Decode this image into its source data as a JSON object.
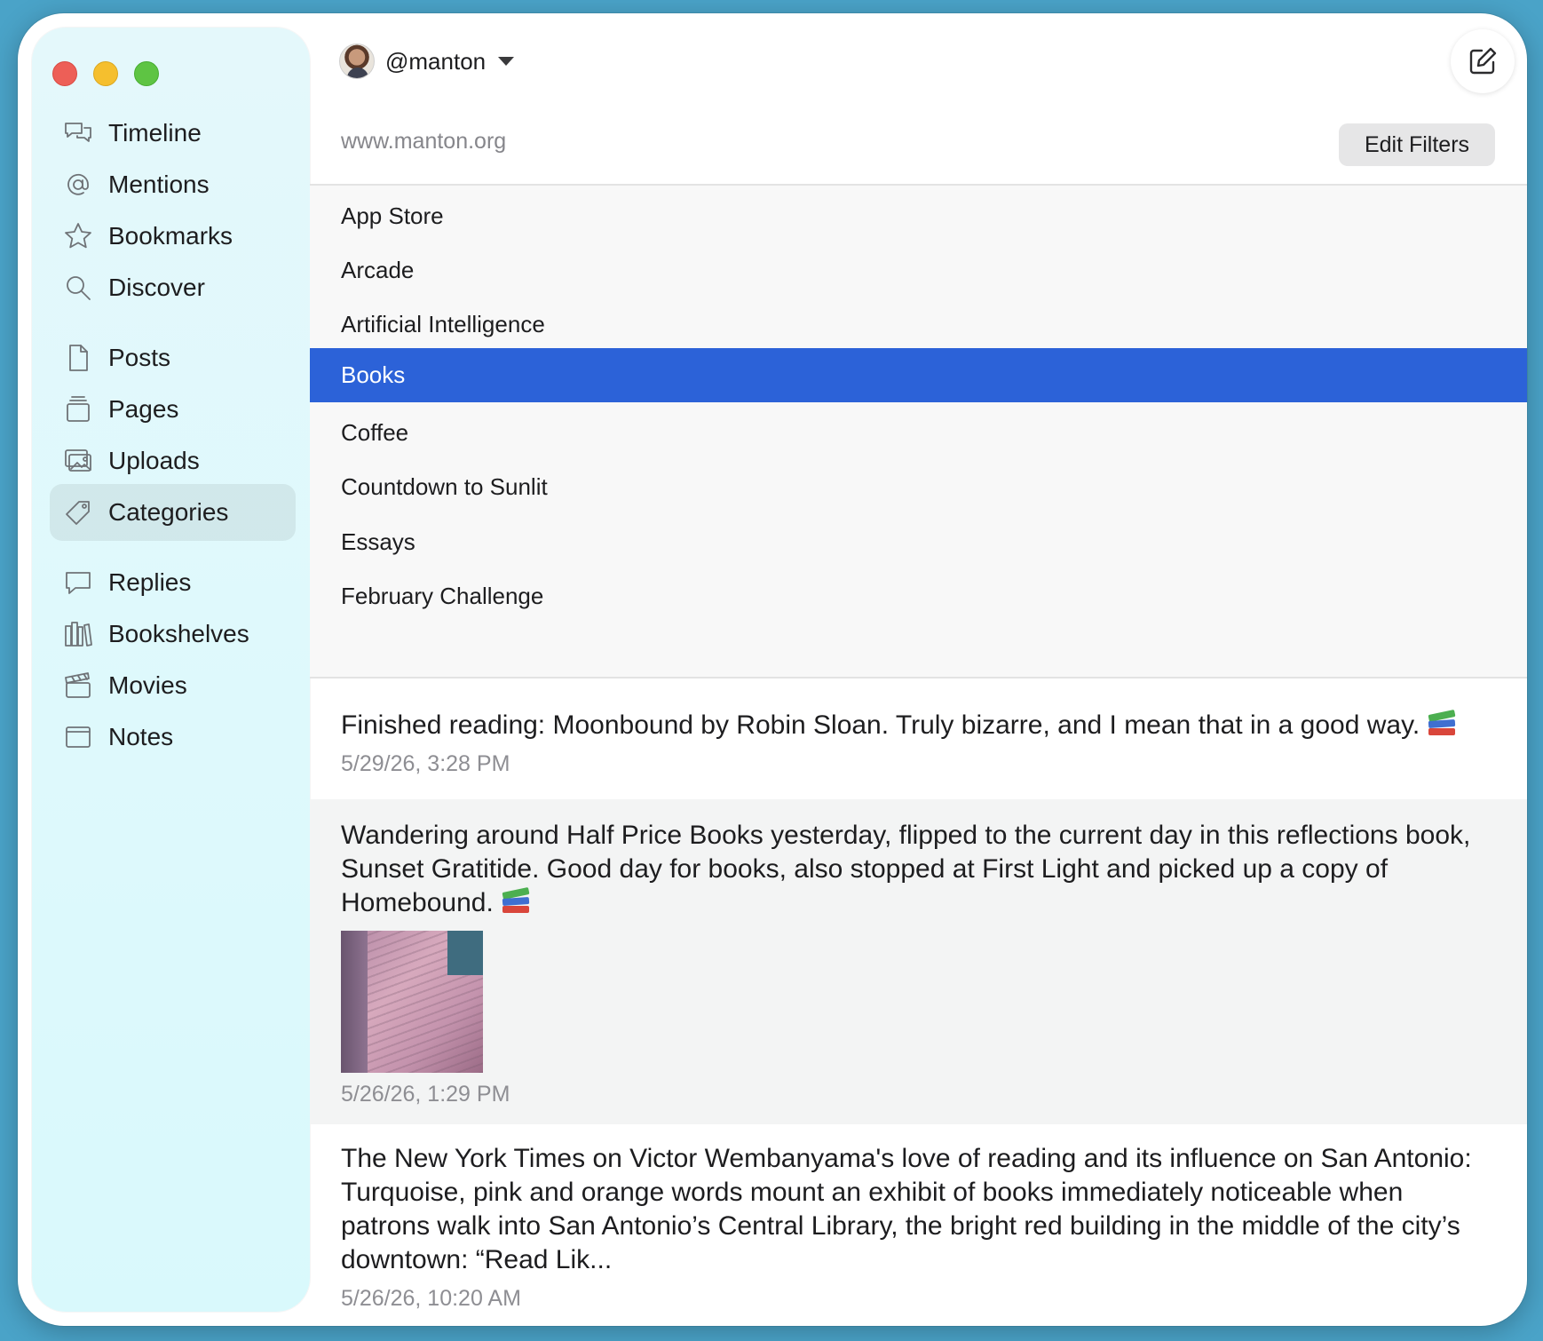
{
  "sidebar": {
    "items": [
      {
        "id": "timeline",
        "label": "Timeline",
        "icon": "chat-bubbles-icon"
      },
      {
        "id": "mentions",
        "label": "Mentions",
        "icon": "at-sign-icon"
      },
      {
        "id": "bookmarks",
        "label": "Bookmarks",
        "icon": "star-icon"
      },
      {
        "id": "discover",
        "label": "Discover",
        "icon": "magnifying-glass-icon"
      },
      {
        "id": "posts",
        "label": "Posts",
        "icon": "document-icon"
      },
      {
        "id": "pages",
        "label": "Pages",
        "icon": "stacked-pages-icon"
      },
      {
        "id": "uploads",
        "label": "Uploads",
        "icon": "photos-icon"
      },
      {
        "id": "categories",
        "label": "Categories",
        "icon": "tag-icon",
        "selected": true
      },
      {
        "id": "replies",
        "label": "Replies",
        "icon": "speech-bubble-icon"
      },
      {
        "id": "bookshelves",
        "label": "Bookshelves",
        "icon": "books-icon"
      },
      {
        "id": "movies",
        "label": "Movies",
        "icon": "clapperboard-icon"
      },
      {
        "id": "notes",
        "label": "Notes",
        "icon": "window-icon"
      }
    ]
  },
  "header": {
    "account": "@manton",
    "site": "www.manton.org",
    "edit_filters_label": "Edit Filters",
    "compose_icon": "compose-icon"
  },
  "categories": [
    {
      "label": "App Store"
    },
    {
      "label": "Arcade"
    },
    {
      "label": "Artificial Intelligence"
    },
    {
      "label": "Books",
      "selected": true
    },
    {
      "label": "Coffee"
    },
    {
      "label": "Countdown to Sunlit"
    },
    {
      "label": "Essays"
    },
    {
      "label": "February Challenge"
    }
  ],
  "posts": [
    {
      "text": "Finished reading: Moonbound by Robin Sloan. Truly bizarre, and I mean that in a good way.",
      "emoji": "books-emoji",
      "date": "5/29/26, 3:28 PM"
    },
    {
      "text": "Wandering around Half Price Books yesterday, flipped to the current day in this reflections book, Sunset Gratitide. Good day for books, also stopped at First Light and picked up a copy of Homebound.",
      "emoji": "books-emoji",
      "has_photo": true,
      "date": "5/26/26, 1:29 PM"
    },
    {
      "text": "The New York Times on Victor Wembanyama's love of reading and its influence on San Antonio:  Turquoise, pink and orange words mount an exhibit of books immediately noticeable when patrons walk into San Antonio’s Central Library, the bright red building in the middle of the city’s downtown: “Read Lik...",
      "date": "5/26/26, 10:20 AM"
    }
  ],
  "colors": {
    "selection": "#2c62d8",
    "background": "#4aa3c8",
    "sidebar": "#def9fc"
  }
}
